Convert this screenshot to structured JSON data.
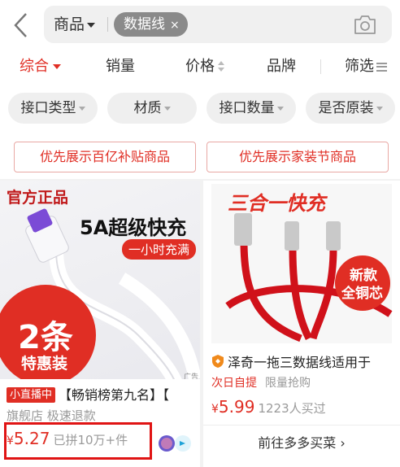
{
  "search": {
    "scope_label": "商品",
    "query_chip": "数据线",
    "chip_clear": "×"
  },
  "sort": {
    "items": [
      "综合",
      "销量",
      "价格",
      "品牌",
      "筛选"
    ]
  },
  "attributes": [
    "接口类型",
    "材质",
    "接口数量",
    "是否原装"
  ],
  "promos": [
    "优先展示百亿补贴商品",
    "优先展示家装节商品"
  ],
  "products": [
    {
      "image_texts": {
        "official": "官方正品",
        "headline": "5A超级快充",
        "ribbon": "一小时充满",
        "count": "2条",
        "deal": "特惠装",
        "ad": "广告"
      },
      "live_badge": "小直播中",
      "title": "【畅销榜第九名】【",
      "sub": "旗舰店  极速退款",
      "currency": "¥",
      "price": "5.27",
      "sold": "已拼10万+件"
    },
    {
      "image_texts": {
        "banner": "三合一快充",
        "badge_line1": "新款",
        "badge_line2": "全铜芯"
      },
      "title": "泽奇一拖三数据线适用于",
      "tag1": "次日自提",
      "tag2": "限量抢购",
      "currency": "¥",
      "price": "5.99",
      "sold": "1223人买过",
      "more_button": "前往多多买菜 ›"
    }
  ],
  "colors": {
    "accent": "#e02e24",
    "highlight_box": "#e01414"
  }
}
